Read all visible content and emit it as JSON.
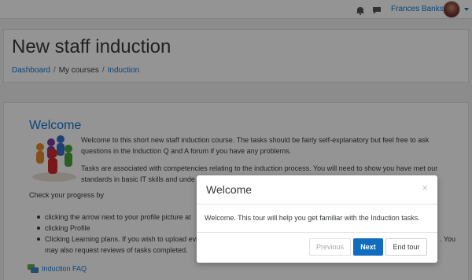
{
  "navbar": {
    "user_name": "Frances Banks",
    "icons": [
      "bell-icon",
      "chat-icon",
      "avatar",
      "chevron-down-icon"
    ]
  },
  "header": {
    "page_title": "New staff induction",
    "breadcrumb": {
      "item1": "Dashboard",
      "sep1": "/",
      "item2": "My courses",
      "sep2": "/",
      "item3": "Induction"
    }
  },
  "content": {
    "section_title": "Welcome",
    "intro_line1": "Welcome to this short new staff induction course. The tasks should be fairly self-explanatory but feel free to ask",
    "intro_line2": "questions in the Induction Q and A forum if you have any problems.",
    "tasks_line1": "Tasks are associated with competencies relating to the induction process. You will need to show you have met our",
    "tasks_line2": "standards in basic IT skills and unde",
    "check_progress": "Check your progress by",
    "list_item1": "clicking the arrow next to your profile picture at",
    "list_item2": "clicking Profile",
    "list_item3": "Clicking Learning plans. If you wish to upload evi",
    "list_item3_tail": ". You",
    "list_item4": "may also request reviews of tasks completed.",
    "faq_link": "Induction FAQ"
  },
  "dialog": {
    "title": "Welcome",
    "close": "×",
    "body": "Welcome. This tour will help you get familiar with the Induction tasks.",
    "prev_label": "Previous",
    "next_label": "Next",
    "end_label": "End tour"
  },
  "colors": {
    "link": "#1177d1",
    "primary_button": "#0f6cbf",
    "backdrop": "rgba(0,0,0,0.42)"
  }
}
